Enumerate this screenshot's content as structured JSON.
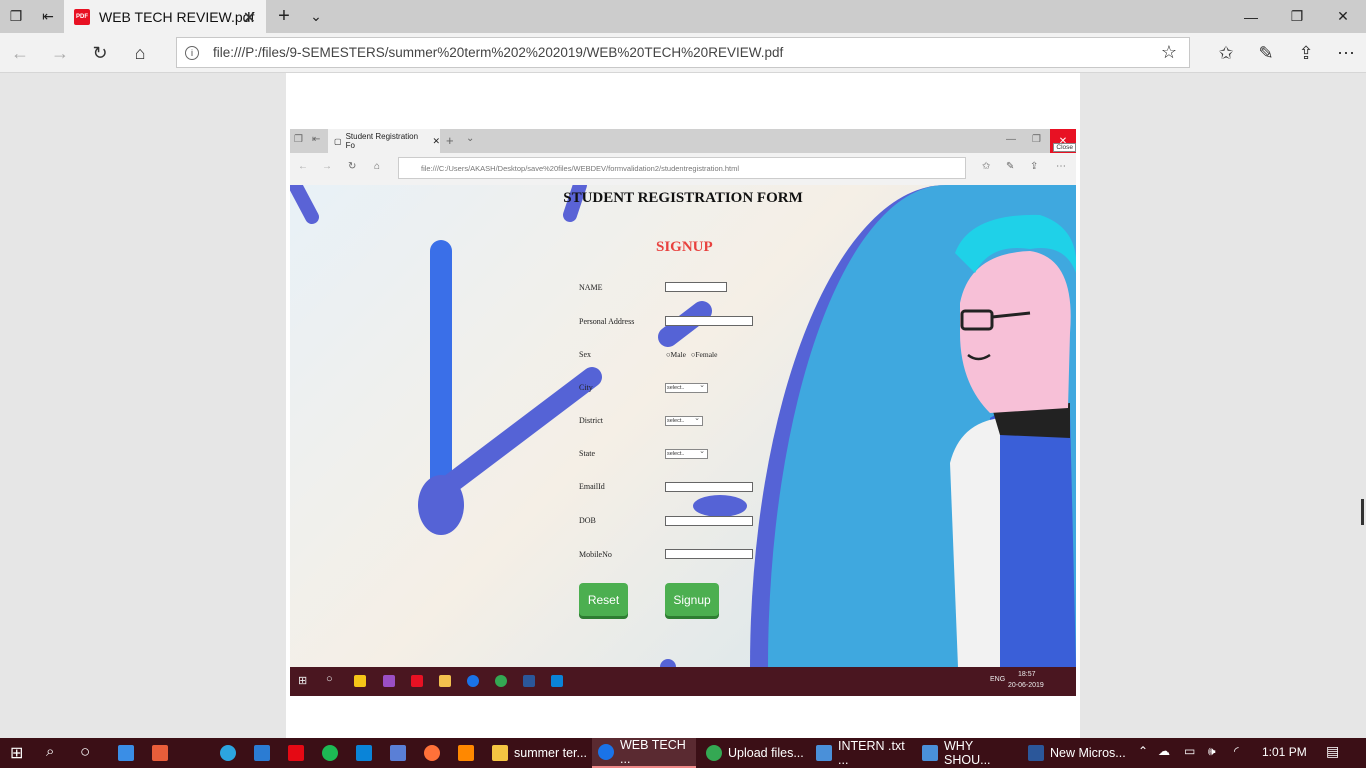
{
  "browser": {
    "tab_title": "WEB TECH REVIEW.pdf",
    "address": "file:///P:/files/9-SEMESTERS/summer%20term%202%202019/WEB%20TECH%20REVIEW.pdf"
  },
  "inner_browser": {
    "tab_title": "Student Registration Fo",
    "address": "file:///C:/Users/AKASH/Desktop/save%20files/WEBDEV/formvalidation2/studentregistration.html",
    "close_tooltip": "Close"
  },
  "form": {
    "title": "STUDENT REGISTRATION FORM",
    "signup_heading": "SIGNUP",
    "labels": {
      "name": "NAME",
      "address": "Personal Address",
      "sex": "Sex",
      "city": "City",
      "district": "District",
      "state": "State",
      "email": "EmailId",
      "dob": "DOB",
      "mobile": "MobileNo"
    },
    "sex_options": {
      "male": "Male",
      "female": "Female"
    },
    "select_placeholder": "select..",
    "reset_label": "Reset",
    "signup_label": "Signup"
  },
  "inner_tray": {
    "lang": "ENG",
    "time": "18:57",
    "date": "20-06-2019"
  },
  "taskbar": {
    "apps": [
      {
        "label": "summer ter...",
        "color": "#f5c542"
      },
      {
        "label": "WEB TECH ...",
        "color": "#1a73e8"
      },
      {
        "label": "Upload files...",
        "color": "#34a853"
      },
      {
        "label": "INTERN .txt ...",
        "color": "#4a90d9"
      },
      {
        "label": "WHY SHOU...",
        "color": "#4a90d9"
      },
      {
        "label": "New Micros...",
        "color": "#2b579a"
      }
    ],
    "clock": "1:01 PM"
  },
  "colors": {
    "accent_red": "#e81123",
    "signup_red": "#e8423f",
    "button_green": "#4caf50",
    "taskbar": "#3b0f16"
  }
}
